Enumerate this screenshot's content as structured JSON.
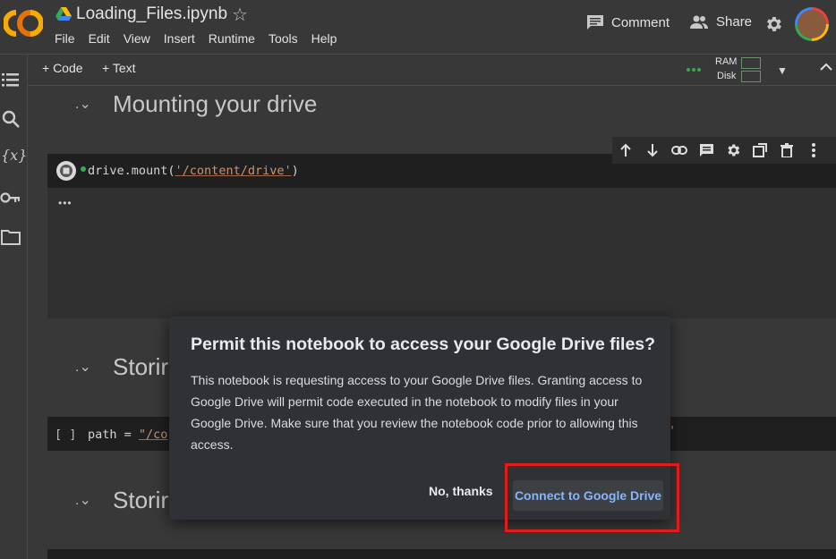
{
  "header": {
    "notebook_title": "Loading_Files.ipynb",
    "menu": [
      "File",
      "Edit",
      "View",
      "Insert",
      "Runtime",
      "Tools",
      "Help"
    ],
    "comment_label": "Comment",
    "share_label": "Share"
  },
  "toolbar": {
    "add_code_label": "+ Code",
    "add_text_label": "+ Text",
    "ram_label": "RAM",
    "disk_label": "Disk"
  },
  "sections": [
    {
      "title": "Mounting your drive"
    },
    {
      "title": "Storir"
    },
    {
      "title": "Storir"
    }
  ],
  "cells": {
    "mount": {
      "prefix": "drive.mount(",
      "string": "'/content/drive'",
      "suffix": ")"
    },
    "output_ellipsis": "•••",
    "path": {
      "run_marker": "[ ]",
      "prefix": "path = ",
      "string": "\"/co"
    },
    "path_tail": "'"
  },
  "dialog": {
    "title": "Permit this notebook to access your Google Drive files?",
    "body": "This notebook is requesting access to your Google Drive files. Granting access to Google Drive will permit code executed in the notebook to modify files in your Google Drive. Make sure that you review the notebook code prior to allowing this access.",
    "cancel_label": "No, thanks",
    "confirm_label": "Connect to Google Drive"
  },
  "colors": {
    "accent": "#8ab4f8",
    "highlight": "#e21b1b",
    "connected": "#34a853"
  }
}
